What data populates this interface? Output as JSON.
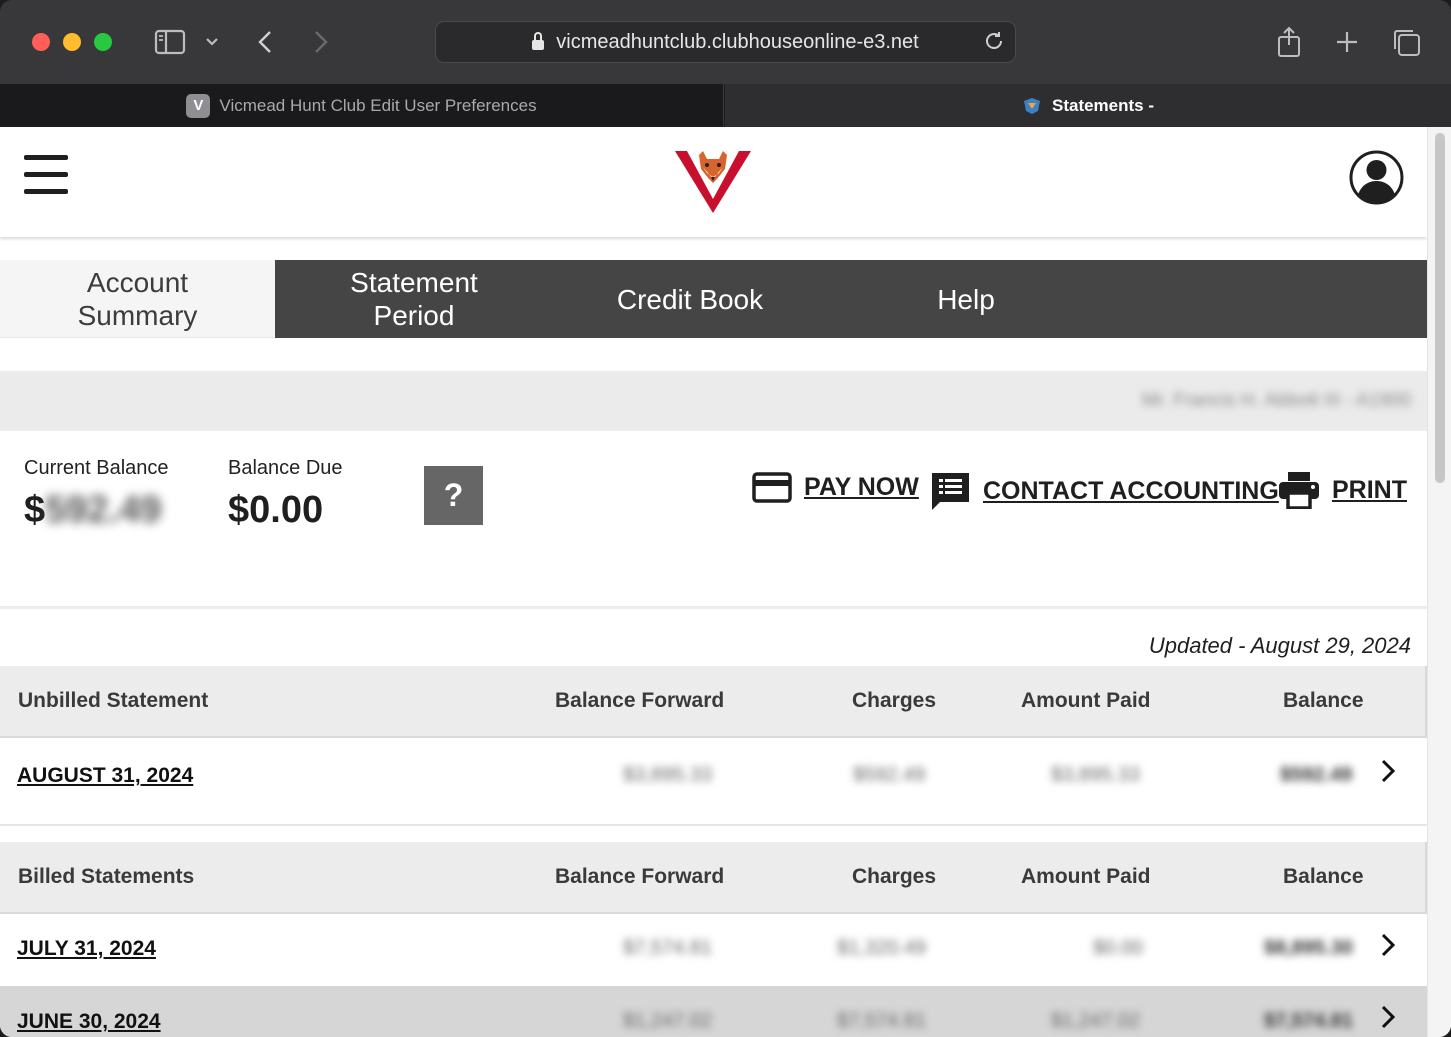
{
  "browser": {
    "url": "vicmeadhuntclub.clubhouseonline-e3.net",
    "tabs": [
      {
        "label": "Vicmead Hunt Club Edit User Preferences",
        "favicon_letter": "V"
      },
      {
        "label": "Statements -"
      }
    ]
  },
  "nav": {
    "tabs": [
      {
        "label_line1": "Account",
        "label_line2": "Summary"
      },
      {
        "label_line1": "Statement",
        "label_line2": "Period"
      },
      {
        "label": "Credit Book"
      },
      {
        "label": "Help"
      }
    ]
  },
  "member": {
    "name_id": "Mr. Francis H. Abbott III - A1900"
  },
  "balances": {
    "current_label": "Current Balance",
    "current_symbol": "$",
    "current_value": "592.49",
    "due_label": "Balance Due",
    "due_value": "$0.00",
    "help_label": "?"
  },
  "actions": {
    "pay_now": "PAY NOW",
    "contact": "CONTACT ACCOUNTING",
    "print": "PRINT"
  },
  "updated": "Updated - August 29, 2024",
  "unbilled": {
    "headers": [
      "Unbilled Statement",
      "Balance Forward",
      "Charges",
      "Amount Paid",
      "Balance"
    ],
    "rows": [
      {
        "date": "AUGUST 31, 2024",
        "balance_forward": "$3,895.33",
        "charges": "$592.49",
        "amount_paid": "$3,895.33",
        "balance": "$592.49"
      }
    ]
  },
  "billed": {
    "headers": [
      "Billed Statements",
      "Balance Forward",
      "Charges",
      "Amount Paid",
      "Balance"
    ],
    "rows": [
      {
        "date": "JULY 31, 2024",
        "balance_forward": "$7,574.81",
        "charges": "$1,320.49",
        "amount_paid": "$0.00",
        "balance": "$8,895.30"
      },
      {
        "date": "JUNE 30, 2024",
        "balance_forward": "$1,247.02",
        "charges": "$7,574.81",
        "amount_paid": "$1,247.02",
        "balance": "$7,574.81"
      }
    ]
  },
  "colors": {
    "nav_bg": "#454545",
    "header_row_bg": "#ececec",
    "logo_red": "#c8102e",
    "fox_orange": "#d9642b"
  }
}
